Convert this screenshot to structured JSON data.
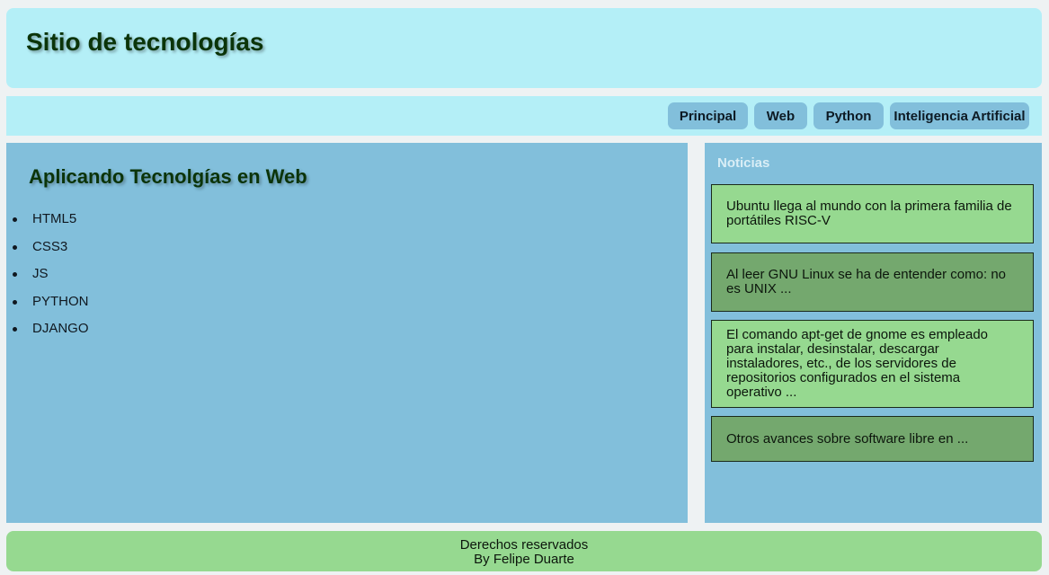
{
  "header": {
    "title": "Sitio de tecnologías"
  },
  "nav": {
    "items": [
      {
        "label": "Principal"
      },
      {
        "label": "Web"
      },
      {
        "label": "Python"
      },
      {
        "label": "Inteligencia Artificial"
      }
    ]
  },
  "main": {
    "title": "Aplicando Tecnolgías en Web",
    "technologies": [
      "HTML5",
      "CSS3",
      "JS",
      "PYTHON",
      "DJANGO"
    ]
  },
  "sidebar": {
    "title": "Noticias",
    "news": [
      {
        "text": "Ubuntu llega al mundo con la primera familia de portátiles RISC-V"
      },
      {
        "text": "Al leer GNU Linux se ha de entender como: no es UNIX ..."
      },
      {
        "text": "El comando apt-get de gnome es empleado para instalar, desinstalar, descargar instaladores, etc., de los servidores de repositorios configurados en el sistema operativo ..."
      },
      {
        "text": "Otros avances sobre software libre en ..."
      }
    ]
  },
  "footer": {
    "line1": "Derechos reservados",
    "line2": "By Felipe Duarte"
  },
  "colors": {
    "header_bg": "#b4eff7",
    "nav_button_bg": "#82bfdb",
    "content_bg": "#82bfdb",
    "news_light_bg": "#96d990",
    "news_dark_bg": "#74a86e",
    "footer_bg": "#96d990",
    "title_color": "#0b3409"
  }
}
